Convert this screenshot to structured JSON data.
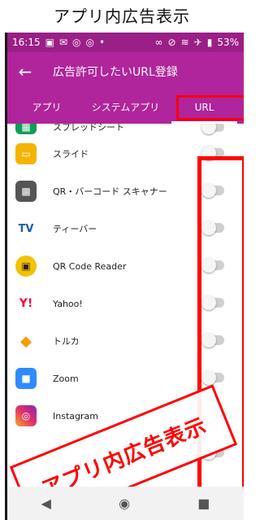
{
  "caption": "アプリ内広告表示",
  "statusbar": {
    "time": "16:15",
    "left_icons": [
      "image-icon",
      "mail-icon",
      "instagram-icon",
      "instagram-icon",
      "dot-icon"
    ],
    "right_icons": [
      "link-icon",
      "mute-icon",
      "wifi-icon",
      "airplane-icon",
      "battery-icon"
    ],
    "battery": "53%"
  },
  "appbar": {
    "title": "広告許可したいURL登録"
  },
  "tabs": [
    {
      "label": "アプリ",
      "selected": false
    },
    {
      "label": "システムアプリ",
      "selected": false
    },
    {
      "label": "URL",
      "selected": true
    }
  ],
  "apps": [
    {
      "name": "スプレッドシート",
      "icon": "sheets-icon",
      "color": "#0F9D58",
      "enabled": false
    },
    {
      "name": "スライド",
      "icon": "slides-icon",
      "color": "#F4B400",
      "enabled": false
    },
    {
      "name": "QR・バーコード スキャナー",
      "icon": "qr-icon",
      "color": "#555555",
      "enabled": false
    },
    {
      "name": "ティーバー",
      "icon": "tver-icon",
      "color": "#1b5fb8",
      "enabled": false
    },
    {
      "name": "QR Code Reader",
      "icon": "qr-reader-icon",
      "color": "#f2c200",
      "enabled": false
    },
    {
      "name": "Yahoo!",
      "icon": "yahoo-icon",
      "color": "#ff0033",
      "enabled": false
    },
    {
      "name": "トルカ",
      "icon": "toruca-icon",
      "color": "#f59c00",
      "enabled": false
    },
    {
      "name": "Zoom",
      "icon": "zoom-icon",
      "color": "#2D8CFF",
      "enabled": false
    },
    {
      "name": "Instagram",
      "icon": "instagram-icon",
      "color": "#e1306c",
      "enabled": false
    }
  ],
  "stamp_text": "アプリ内広告表示",
  "navbar": {
    "back": "◀",
    "home": "◉",
    "recents": "■"
  }
}
